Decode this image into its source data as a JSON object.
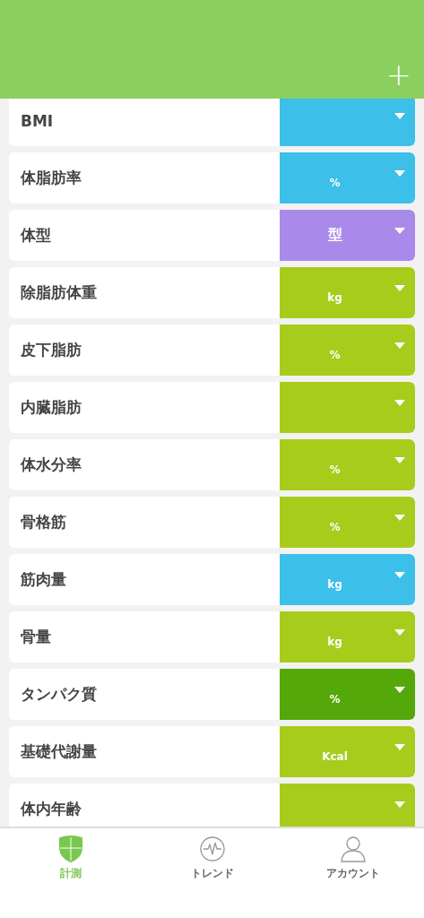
{
  "header": {
    "add_button": "+"
  },
  "metrics": [
    {
      "label": "BMI",
      "color": "#3cbfe8"
    },
    {
      "label": "体脂肪率",
      "unit": "%",
      "color": "#3cbfe8"
    },
    {
      "label": "体型",
      "unit": "型",
      "color": "#a98aea"
    },
    {
      "label": "除脂肪体重",
      "unit": "kg",
      "color": "#a8cc1c"
    },
    {
      "label": "皮下脂肪",
      "unit": "%",
      "color": "#a8cc1c"
    },
    {
      "label": "内臓脂肪",
      "color": "#a8cc1c"
    },
    {
      "label": "体水分率",
      "unit": "%",
      "color": "#a8cc1c"
    },
    {
      "label": "骨格筋",
      "unit": "%",
      "color": "#a8cc1c"
    },
    {
      "label": "筋肉量",
      "unit": "kg",
      "color": "#3cbfe8"
    },
    {
      "label": "骨量",
      "unit": "kg",
      "color": "#a8cc1c"
    },
    {
      "label": "タンパク質",
      "unit": "%",
      "color": "#55a80a"
    },
    {
      "label": "基礎代謝量",
      "unit": "Kcal",
      "color": "#a8cc1c"
    },
    {
      "label": "体内年齢",
      "color": "#a8cc1c"
    }
  ],
  "tabs": [
    {
      "kind": "measure",
      "label": "計測",
      "selected": true
    },
    {
      "kind": "trend",
      "label": "トレンド",
      "selected": false
    },
    {
      "kind": "account",
      "label": "アカウント",
      "selected": false
    }
  ]
}
